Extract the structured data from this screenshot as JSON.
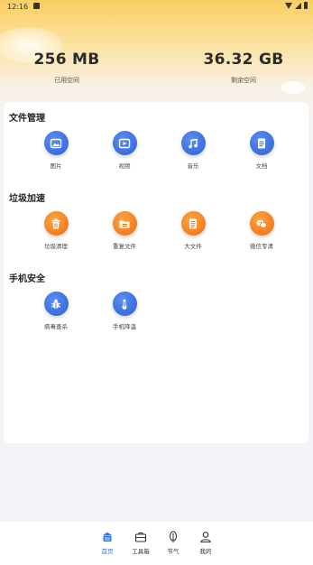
{
  "status_bar": {
    "time": "12:16"
  },
  "storage": {
    "used_value": "256 MB",
    "used_label": "已用空间",
    "free_value": "36.32 GB",
    "free_label": "剩余空间"
  },
  "sections": [
    {
      "title": "文件管理",
      "items": [
        {
          "label": "图片",
          "icon": "image-icon"
        },
        {
          "label": "视频",
          "icon": "video-icon"
        },
        {
          "label": "音乐",
          "icon": "music-icon"
        },
        {
          "label": "文档",
          "icon": "document-icon"
        }
      ]
    },
    {
      "title": "垃圾加速",
      "items": [
        {
          "label": "垃圾清理",
          "icon": "trash-icon"
        },
        {
          "label": "重复文件",
          "icon": "folder-icon"
        },
        {
          "label": "大文件",
          "icon": "file-icon"
        },
        {
          "label": "微信专清",
          "icon": "wechat-icon"
        }
      ]
    },
    {
      "title": "手机安全",
      "items": [
        {
          "label": "病毒查杀",
          "icon": "bug-icon"
        },
        {
          "label": "手机降温",
          "icon": "thermometer-icon"
        }
      ]
    }
  ],
  "tabbar": {
    "items": [
      {
        "label": "首页",
        "icon": "home-icon",
        "active": true
      },
      {
        "label": "工具箱",
        "icon": "toolbox-icon",
        "active": false
      },
      {
        "label": "节气",
        "icon": "leaf-icon",
        "active": false
      },
      {
        "label": "我的",
        "icon": "profile-icon",
        "active": false
      }
    ]
  },
  "colors": {
    "accent_blue": "#2d5fd6",
    "accent_orange": "#f16a10",
    "tab_active": "#2a7ae4"
  }
}
